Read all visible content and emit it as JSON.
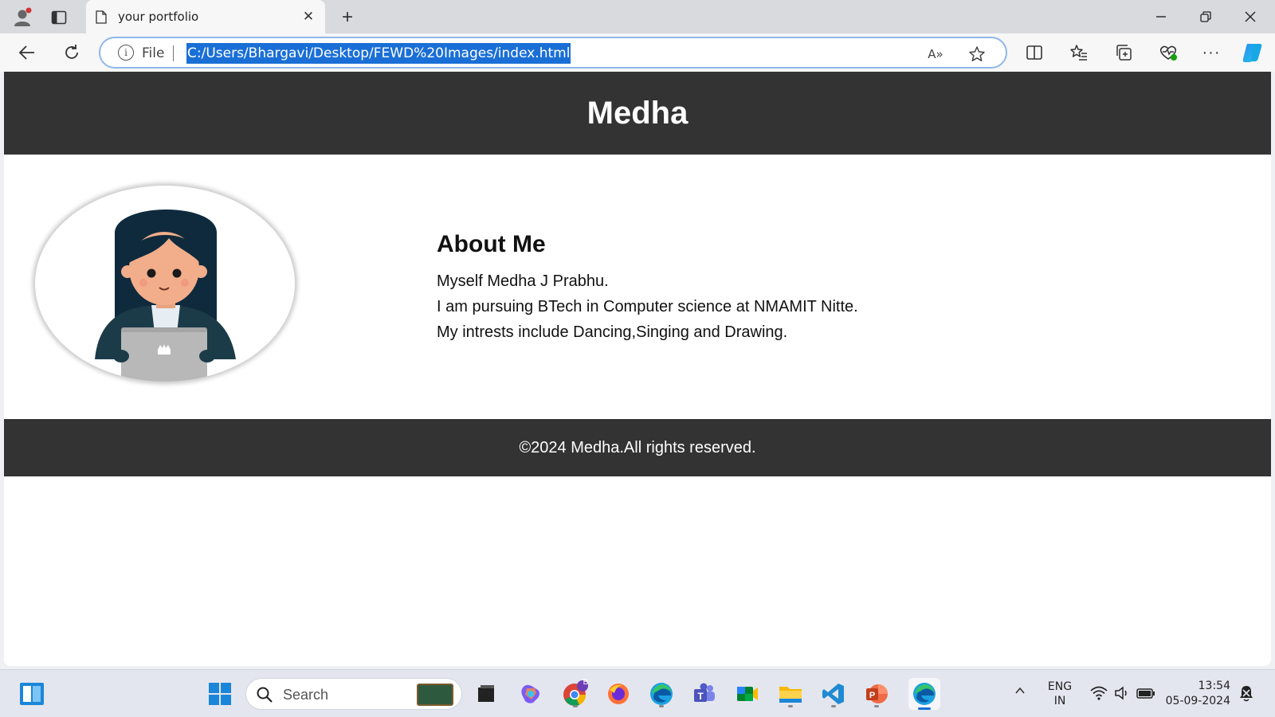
{
  "browser": {
    "tab_title": "your portfolio",
    "url_scheme_label": "File",
    "address": "C:/Users/Bhargavi/Desktop/FEWD%20Images/index.html",
    "read_aloud_label": "A»",
    "more_label": "···",
    "accent": "#1a6fd6"
  },
  "site": {
    "header_title": "Medha",
    "about_heading": "About Me",
    "about_lines": [
      "Myself Medha J Prabhu.",
      "I am pursuing BTech in Computer science at NMAMIT Nitte.",
      "My intrests include Dancing,Singing and Drawing."
    ],
    "footer_text": "©2024 Medha.All rights reserved.",
    "header_bg": "#333333",
    "footer_bg": "#333333"
  },
  "taskbar": {
    "search_placeholder": "Search",
    "chrome_badge": "B",
    "language": "ENG",
    "region": "IN",
    "time": "13:54",
    "date": "05-09-2024"
  },
  "icons": [
    "profile-icon",
    "tab-actions-icon",
    "page-icon",
    "close-icon",
    "plus-icon",
    "minimize-icon",
    "restore-icon",
    "back-icon",
    "reload-icon",
    "info-icon",
    "star-icon",
    "split-screen-icon",
    "favorites-icon",
    "collections-icon",
    "performance-icon",
    "copilot-icon",
    "widgets-icon",
    "windows-start-icon",
    "search-icon",
    "wifi-icon",
    "volume-icon",
    "battery-icon",
    "notification-icon"
  ]
}
